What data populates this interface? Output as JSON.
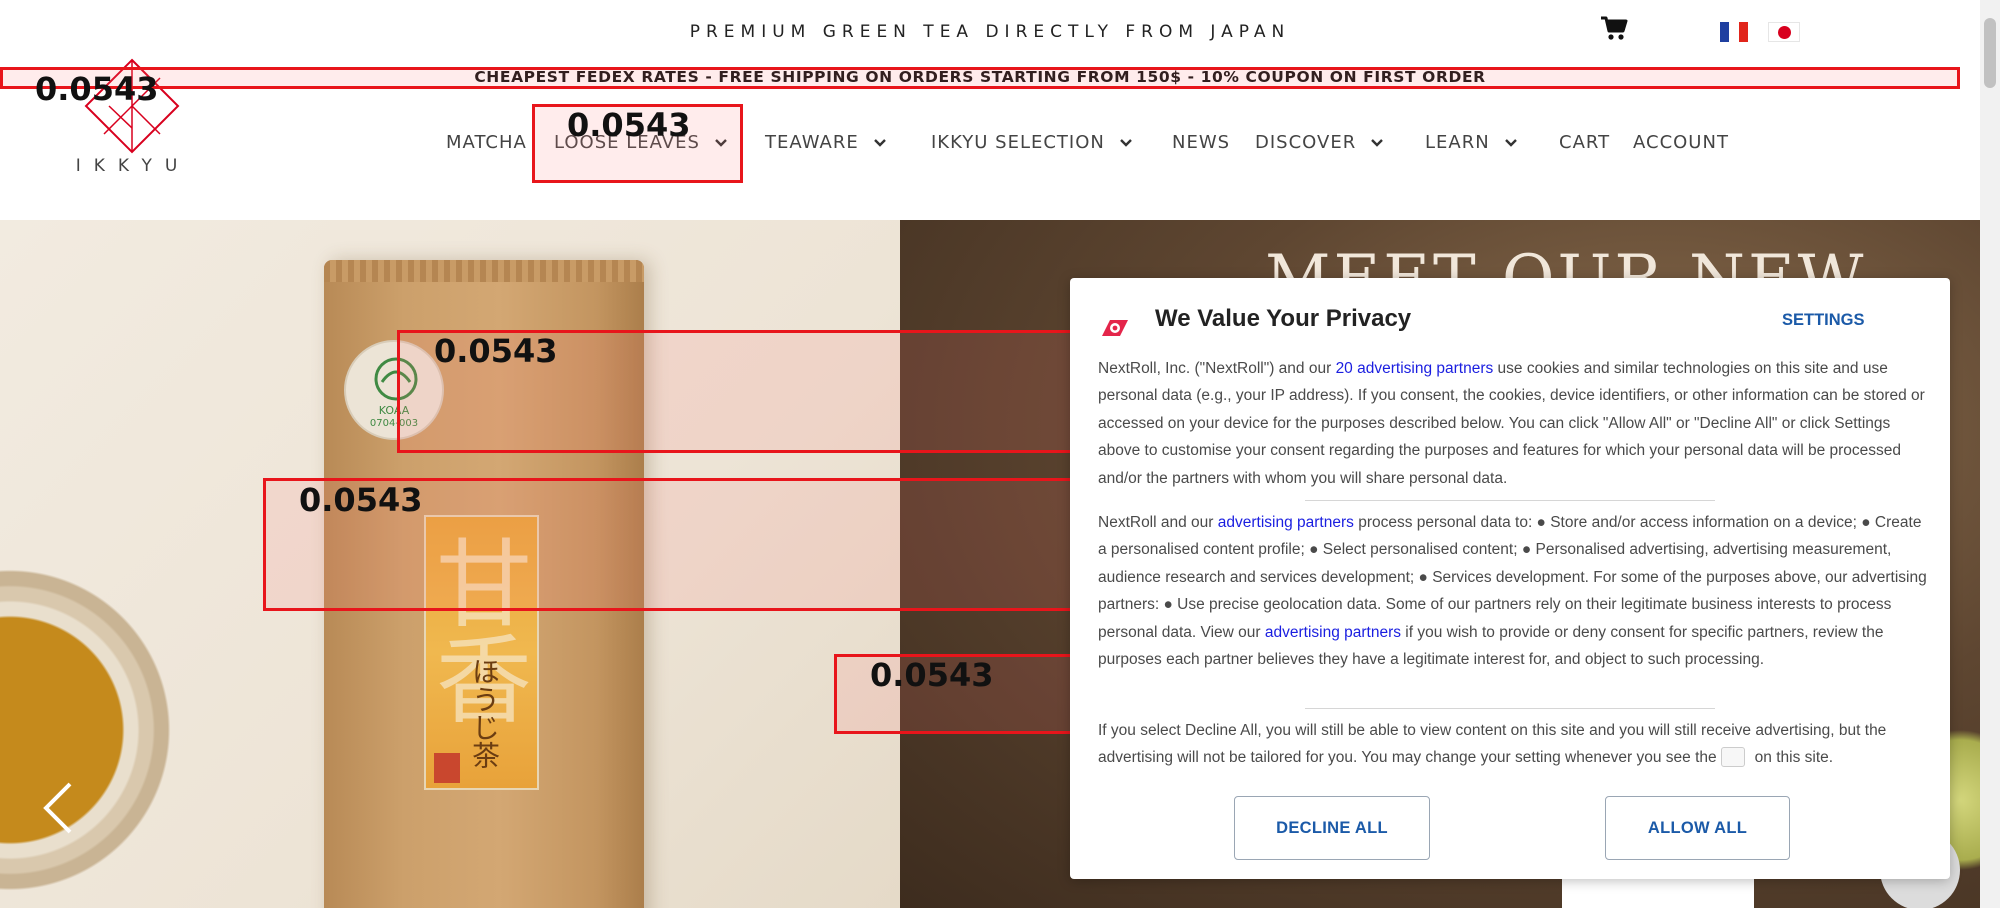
{
  "top_bar": {
    "tagline": "PREMIUM GREEN TEA DIRECTLY FROM JAPAN",
    "cart_icon": "cart-icon",
    "languages": [
      "fr",
      "jp"
    ]
  },
  "banner": {
    "text": "CHEAPEST FEDEX RATES - FREE SHIPPING ON ORDERS STARTING FROM 150$ - 10% COUPON ON FIRST ORDER"
  },
  "logo": {
    "text": "IKKYU"
  },
  "nav": {
    "items": [
      {
        "label": "MATCHA",
        "has_dropdown": false
      },
      {
        "label": "LOOSE LEAVES",
        "has_dropdown": true
      },
      {
        "label": "TEAWARE",
        "has_dropdown": true
      },
      {
        "label": "IKKYU SELECTION",
        "has_dropdown": true
      },
      {
        "label": "NEWS",
        "has_dropdown": false
      },
      {
        "label": "DISCOVER",
        "has_dropdown": true
      },
      {
        "label": "LEARN",
        "has_dropdown": true
      },
      {
        "label": "CART",
        "has_dropdown": false
      },
      {
        "label": "ACCOUNT",
        "has_dropdown": false
      }
    ]
  },
  "hero": {
    "title": "MEET OUR NEW",
    "product_label_kanji": "甘香",
    "product_label_sub": "ほうじ茶",
    "seal_text": "KOAA",
    "seal_code": "0704-003",
    "prev_arrow": "chevron-left-icon"
  },
  "overlay_scores": [
    "0.0543",
    "0.0543",
    "0.0543",
    "0.0543",
    "0.0543"
  ],
  "privacy_dialog": {
    "title": "We Value Your Privacy",
    "settings_label": "SETTINGS",
    "para1_a": "NextRoll, Inc. (\"NextRoll\") and our ",
    "para1_link": "20 advertising partners",
    "para1_b": " use cookies and similar technologies on this site and use personal data (e.g., your IP address). If you consent, the cookies, device identifiers, or other information can be stored or accessed on your device for the purposes described below. You can click \"Allow All\" or \"Decline All\" or click Settings above to customise your consent regarding the purposes and features for which your personal data will be processed and/or the partners with whom you will share personal data.",
    "para2_a": "NextRoll and our ",
    "para2_link1": "advertising partners",
    "para2_b": " process personal data to: ● Store and/or access information on a device; ● Create a personalised content profile; ● Select personalised content; ● Personalised advertising, advertising measurement, audience research and services development; ● Services development. For some of the purposes above, our advertising partners: ● Use precise geolocation data. Some of our partners rely on their legitimate business interests to process personal data. View our ",
    "para2_link2": "advertising partners",
    "para2_c": " if you wish to provide or deny consent for specific partners, review the purposes each partner believes they have a legitimate interest for, and object to such processing.",
    "para3_a": "If you select Decline All, you will still be able to view content on this site and you will still receive advertising, but the advertising will not be tailored for you. You may change your setting whenever you see the",
    "para3_b": "on this site.",
    "decline_label": "DECLINE ALL",
    "allow_label": "ALLOW ALL"
  },
  "colors": {
    "accent_link": "#1a1ee0",
    "dialog_button_text": "#1b5aa8",
    "overlay_box": "#e8151b",
    "logo_red": "#d8001e"
  }
}
